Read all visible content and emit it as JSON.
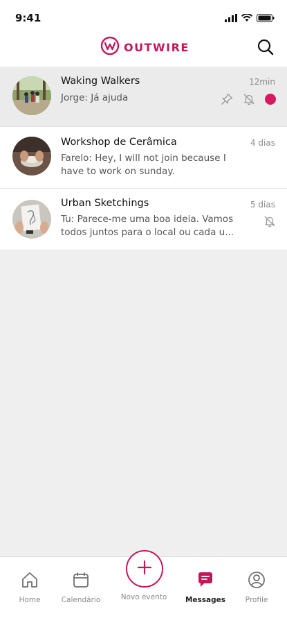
{
  "status_bar": {
    "time": "9:41"
  },
  "header": {
    "logo_text": "OUTWIRE"
  },
  "conversations": [
    {
      "name": "Waking Walkers",
      "time": "12min",
      "preview": "Jorge: Já ajuda",
      "pinned": true,
      "muted": true,
      "unread": true
    },
    {
      "name": "Workshop de Cerâmica",
      "time": "4 dias",
      "preview": "Farelo: Hey, I will not join because I have to work on sunday."
    },
    {
      "name": "Urban Sketchings",
      "time": "5 dias",
      "preview": "Tu: Parece-me uma boa ideia. Vamos todos juntos para o local ou cada u...",
      "muted": true
    }
  ],
  "bottom_nav": {
    "home": "Home",
    "calendar": "Calendário",
    "new_event": "Novo evento",
    "messages": "Messages",
    "profile": "Profile"
  },
  "colors": {
    "accent": "#c2185b",
    "unread_dot": "#d81b60"
  }
}
